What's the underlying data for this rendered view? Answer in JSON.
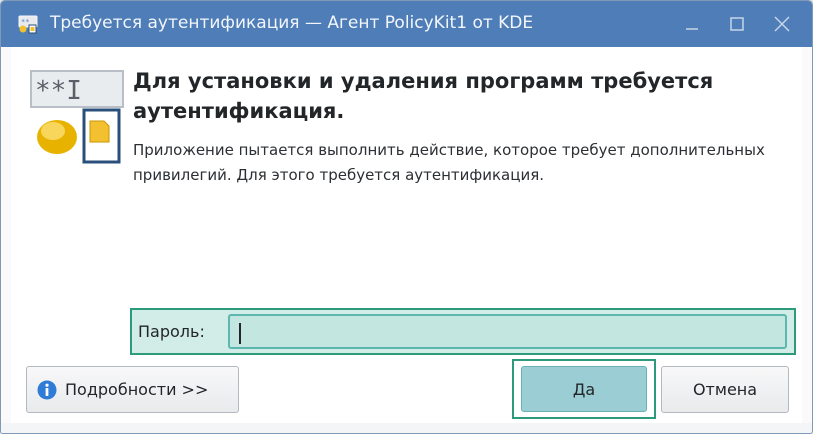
{
  "window": {
    "title": "Требуется аутентификация — Агент PolicyKit1 от KDE",
    "icon": "authentication-icon",
    "controls": [
      "minimize-icon",
      "maximize-icon",
      "close-icon"
    ]
  },
  "dialog": {
    "icon": "password-lock-icon",
    "icon_text": "**I",
    "heading": "Для установки и удаления программ требуется аутентификация.",
    "description": "Приложение пытается выполнить действие, которое требует дополнительных привилегий. Для этого требуется аутентификация."
  },
  "password": {
    "label": "Пароль:",
    "value": "",
    "placeholder": ""
  },
  "buttons": {
    "details_label": "Подробности >>",
    "details_icon": "info-icon",
    "ok_label": "Да",
    "cancel_label": "Отмена"
  },
  "colors": {
    "titlebar": "#4e7db8",
    "focus": "#2d9b7b",
    "input_bg": "#c3e6e1",
    "default_button": "#9bcdd4",
    "info": "#2f7bd6"
  }
}
